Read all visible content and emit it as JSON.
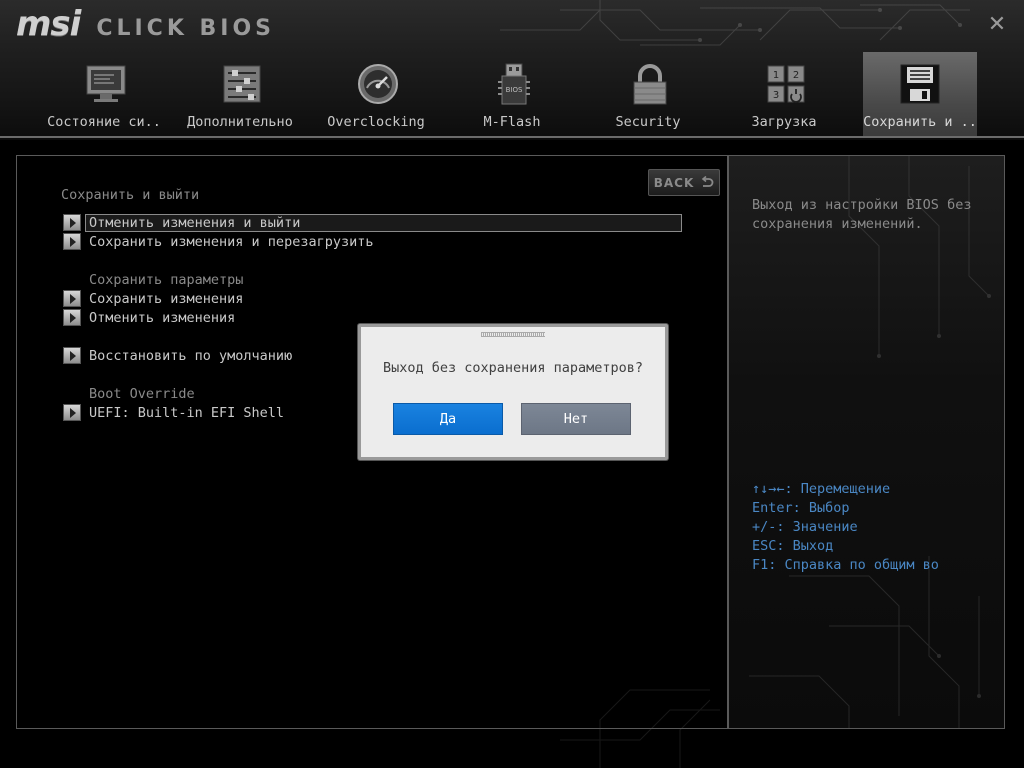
{
  "app": {
    "logo_brand": "msi",
    "logo_product": "CLICK BIOS",
    "close_label": "✕"
  },
  "tabs": [
    {
      "label": "Состояние си..",
      "icon": "monitor-icon",
      "active": false
    },
    {
      "label": "Дополнительно",
      "icon": "settings-sliders-icon",
      "active": false
    },
    {
      "label": "Overclocking",
      "icon": "speedometer-icon",
      "active": false
    },
    {
      "label": "M-Flash",
      "icon": "usb-bios-chip-icon",
      "active": false
    },
    {
      "label": "Security",
      "icon": "padlock-icon",
      "active": false
    },
    {
      "label": "Загрузка",
      "icon": "boot-order-icon",
      "active": false
    },
    {
      "label": "Сохранить и ..",
      "icon": "floppy-disk-icon",
      "active": true
    }
  ],
  "main": {
    "back_label": "BACK",
    "sections": {
      "save_exit_title": "Сохранить и выйти",
      "save_params_title": "Сохранить параметры",
      "boot_override_title": "Boot Override"
    },
    "items": {
      "discard_exit": "Отменить изменения и выйти",
      "save_reboot": "Сохранить изменения и перезагрузить",
      "save_changes": "Сохранить изменения",
      "discard_changes": "Отменить изменения",
      "restore_defaults": "Восстановить по умолчанию",
      "uefi_shell": "UEFI: Built-in EFI Shell"
    }
  },
  "help": {
    "description": "Выход из настройки BIOS без сохранения изменений.",
    "keys": [
      "↑↓→←: Перемещение",
      "Enter: Выбор",
      "+/-: Значение",
      "ESC: Выход",
      "F1: Справка по общим во"
    ]
  },
  "dialog": {
    "message": "Выход без сохранения параметров?",
    "yes_label": "Да",
    "no_label": "Нет"
  },
  "colors": {
    "accent_blue": "#0a6ecf",
    "help_key_blue": "#4a87c4",
    "neutral_button": "#6d7786"
  }
}
